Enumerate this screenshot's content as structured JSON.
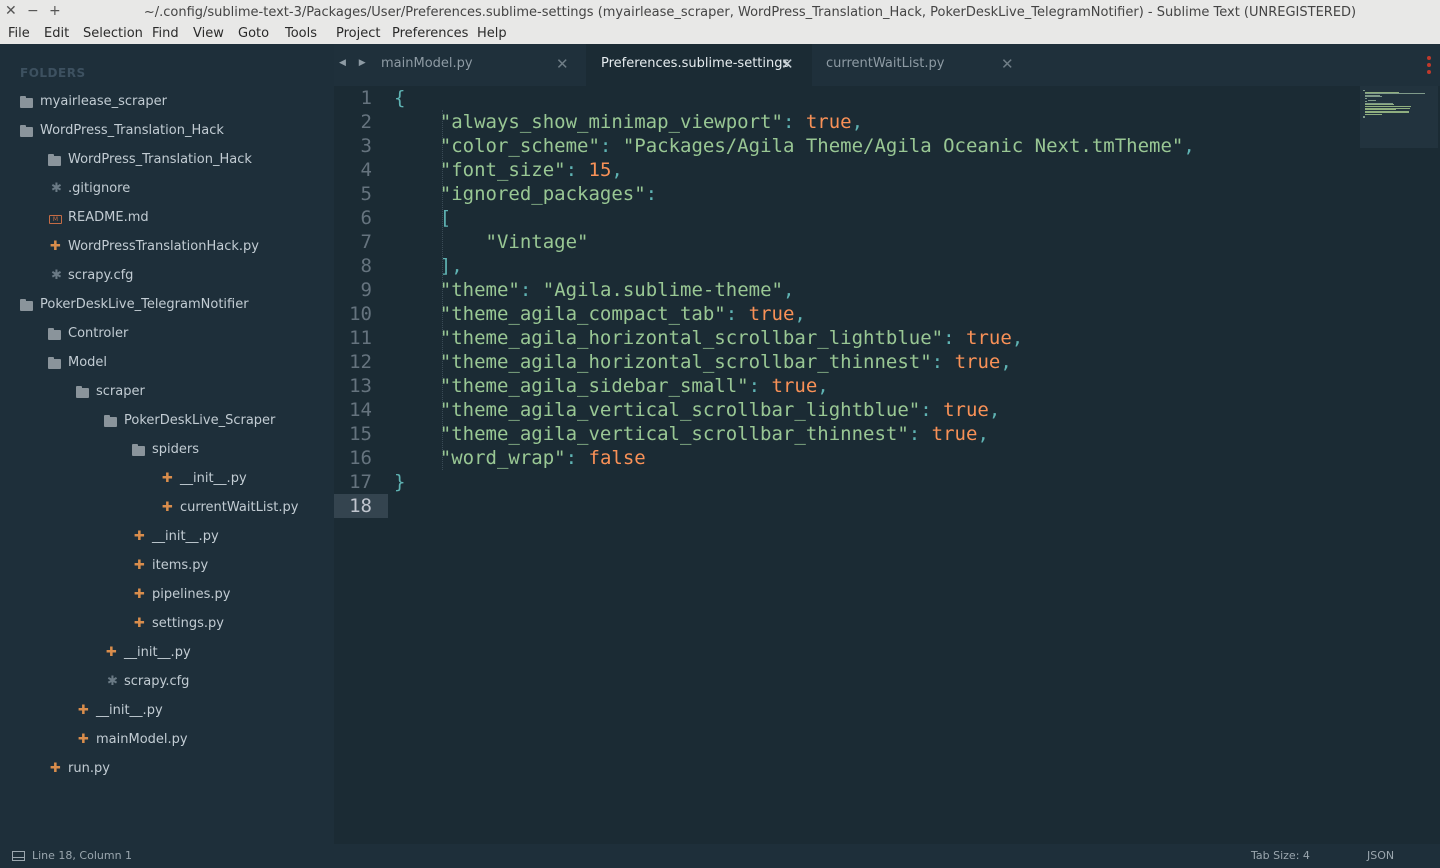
{
  "window": {
    "title": "~/.config/sublime-text-3/Packages/User/Preferences.sublime-settings (myairlease_scraper, WordPress_Translation_Hack, PokerDeskLive_TelegramNotifier) - Sublime Text (UNREGISTERED)",
    "controls": {
      "close": "✕",
      "minimize": "−",
      "maximize": "+"
    }
  },
  "menu": [
    "File",
    "Edit",
    "Selection",
    "Find",
    "View",
    "Goto",
    "Tools",
    "Project",
    "Preferences",
    "Help"
  ],
  "sidebar": {
    "heading": "FOLDERS",
    "items": [
      {
        "label": "myairlease_scraper",
        "icon": "folder-icon"
      },
      {
        "label": "WordPress_Translation_Hack",
        "icon": "folder-open-icon"
      },
      {
        "label": "WordPress_Translation_Hack",
        "icon": "folder-icon"
      },
      {
        "label": ".gitignore",
        "icon": "generic-file-icon"
      },
      {
        "label": "README.md",
        "icon": "markdown-file-icon"
      },
      {
        "label": "WordPressTranslationHack.py",
        "icon": "python-file-icon"
      },
      {
        "label": "scrapy.cfg",
        "icon": "generic-file-icon"
      },
      {
        "label": "PokerDeskLive_TelegramNotifier",
        "icon": "folder-open-icon"
      },
      {
        "label": "Controler",
        "icon": "folder-icon"
      },
      {
        "label": "Model",
        "icon": "folder-open-icon"
      },
      {
        "label": "scraper",
        "icon": "folder-open-icon"
      },
      {
        "label": "PokerDeskLive_Scraper",
        "icon": "folder-open-icon"
      },
      {
        "label": "spiders",
        "icon": "folder-open-icon"
      },
      {
        "label": "__init__.py",
        "icon": "python-file-icon"
      },
      {
        "label": "currentWaitList.py",
        "icon": "python-file-icon"
      },
      {
        "label": "__init__.py",
        "icon": "python-file-icon"
      },
      {
        "label": "items.py",
        "icon": "python-file-icon"
      },
      {
        "label": "pipelines.py",
        "icon": "python-file-icon"
      },
      {
        "label": "settings.py",
        "icon": "python-file-icon"
      },
      {
        "label": "__init__.py",
        "icon": "python-file-icon"
      },
      {
        "label": "scrapy.cfg",
        "icon": "generic-file-icon"
      },
      {
        "label": "__init__.py",
        "icon": "python-file-icon"
      },
      {
        "label": "mainModel.py",
        "icon": "python-file-icon"
      },
      {
        "label": "run.py",
        "icon": "python-file-icon"
      }
    ]
  },
  "tabs": [
    {
      "label": "mainModel.py",
      "active": false,
      "close": "✕"
    },
    {
      "label": "Preferences.sublime-settings",
      "active": true,
      "close": "✕"
    },
    {
      "label": "currentWaitList.py",
      "active": false,
      "close": "✕"
    }
  ],
  "tab_nav": "◀ ▶",
  "editor": {
    "current_line": 18,
    "lines": [
      "{",
      "    \"always_show_minimap_viewport\": true,",
      "    \"color_scheme\": \"Packages/Agila Theme/Agila Oceanic Next.tmTheme\",",
      "    \"font_size\": 15,",
      "    \"ignored_packages\":",
      "    [",
      "        \"Vintage\"",
      "    ],",
      "    \"theme\": \"Agila.sublime-theme\",",
      "    \"theme_agila_compact_tab\": true,",
      "    \"theme_agila_horizontal_scrollbar_lightblue\": true,",
      "    \"theme_agila_horizontal_scrollbar_thinnest\": true,",
      "    \"theme_agila_sidebar_small\": true,",
      "    \"theme_agila_vertical_scrollbar_lightblue\": true,",
      "    \"theme_agila_vertical_scrollbar_thinnest\": true,",
      "    \"word_wrap\": false",
      "}",
      ""
    ]
  },
  "status": {
    "position": "Line 18, Column 1",
    "tab_size": "Tab Size: 4",
    "syntax": "JSON"
  },
  "colors": {
    "background": "#1b2b34",
    "sidebar": "#1e2f3a",
    "string": "#99c794",
    "keyword": "#f99157",
    "punctuation": "#5fb3b3",
    "gutter": "#65737e",
    "py_icon": "#d98d4c"
  }
}
